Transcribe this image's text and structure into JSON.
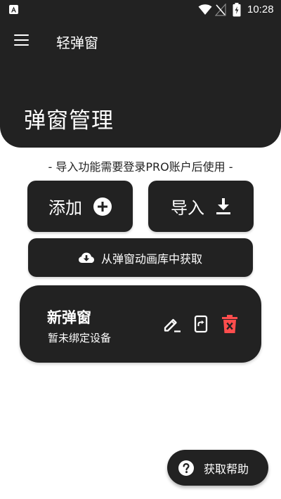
{
  "status_bar": {
    "time": "10:28",
    "icons": [
      "app-notification-icon",
      "wifi-icon",
      "no-signal-icon",
      "battery-charging-icon"
    ]
  },
  "header": {
    "menu_icon": "hamburger-menu-icon",
    "app_title": "轻弹窗",
    "page_title": "弹窗管理"
  },
  "notice": "- 导入功能需要登录PRO账户后使用 -",
  "actions": {
    "add_label": "添加",
    "add_icon": "plus-circle-icon",
    "import_label": "导入",
    "import_icon": "download-icon",
    "library_label": "从弹窗动画库中获取",
    "library_icon": "cloud-download-icon"
  },
  "popups": [
    {
      "name": "新弹窗",
      "status": "暂未绑定设备",
      "actions": [
        "edit-icon",
        "bind-device-icon",
        "delete-icon"
      ]
    }
  ],
  "help": {
    "label": "获取帮助",
    "icon": "help-circle-icon"
  },
  "colors": {
    "dark_surface": "#222222",
    "background": "#ffffff",
    "text_on_dark": "#ffffff",
    "delete_red": "#ff4d4d"
  }
}
